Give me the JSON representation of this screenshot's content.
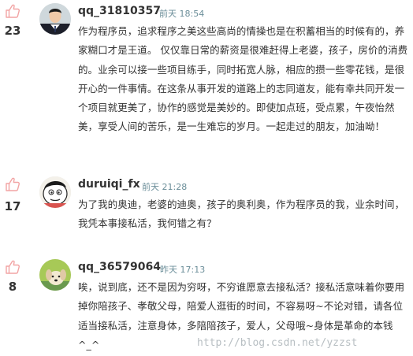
{
  "colors": {
    "thumb_icon": "#f2a4a4",
    "time_text": "#6b8e99",
    "body_text": "#333333",
    "username_text": "#333333",
    "watermark": "#a0aaaf"
  },
  "comments": [
    {
      "votes": "23",
      "vote_icon": "thumbs-up-icon",
      "username": "qq_31810357",
      "time": "前天 18:54",
      "text": "作为程序员，追求程序之美这些高尚的情操也是在积蓄相当的时候有的，养家糊口才是王道。 仅仅靠日常的薪资是很难赶得上老婆，孩子，房价的消费的。业余可以接一些项目练手，同时拓宽人脉，相应的攒一些零花钱，是很开心的一件事情。在这条从事开发的道路上的志同道友，能有幸共同开发一个项目就更美了，协作的感觉是美妙的。即使加点班，受点累，午夜怡然美，享受人间的苦乐，是一生难忘的岁月。一起走过的朋友，加油呦！"
    },
    {
      "votes": "17",
      "vote_icon": "thumbs-up-icon",
      "username": "duruiqi_fx",
      "time": "前天 21:28",
      "text": "为了我的奥迪，老婆的迪奥，孩子的奥利奥，作为程序员的我，业余时间，我凭本事接私活，我何错之有？"
    },
    {
      "votes": "8",
      "vote_icon": "thumbs-up-icon",
      "username": "qq_36579064",
      "time": "昨天 17:13",
      "text": "唉，说到底，还不是因为穷呀，不穷谁愿意去接私活？接私活意味着你要用掉你陪孩子、孝敬父母，陪爱人逛街的时间，不容易呀~不论对错，请各位适当接私活，注意身体，多陪陪孩子，爱人，父母哦~身体是革命的本钱^_^"
    }
  ],
  "watermark": "http://blog.csdn.net/yzzst"
}
